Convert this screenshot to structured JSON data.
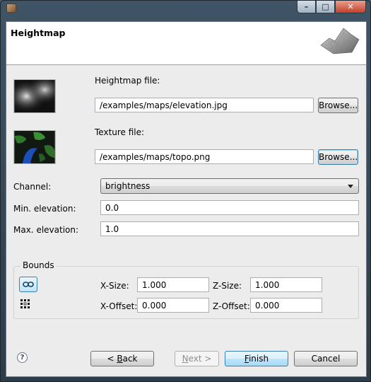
{
  "window": {
    "controls": {
      "minimize": "–",
      "maximize": "□",
      "close": "✕"
    }
  },
  "header": {
    "title": "Heightmap"
  },
  "heightmap": {
    "label": "Heightmap file:",
    "path": "/examples/maps/elevation.jpg",
    "browse_label": "Browse..."
  },
  "texture": {
    "label": "Texture file:",
    "path": "/examples/maps/topo.png",
    "browse_label": "Browse..."
  },
  "channel": {
    "label": "Channel:",
    "value": "brightness"
  },
  "min_elevation": {
    "label": "Min. elevation:",
    "value": "0.0"
  },
  "max_elevation": {
    "label": "Max. elevation:",
    "value": "1.0"
  },
  "bounds": {
    "title": "Bounds",
    "x_size": {
      "label": "X-Size:",
      "value": "1.000"
    },
    "z_size": {
      "label": "Z-Size:",
      "value": "1.000"
    },
    "x_offset": {
      "label": "X-Offset:",
      "value": "0.000"
    },
    "z_offset": {
      "label": "Z-Offset:",
      "value": "0.000"
    }
  },
  "footer": {
    "help": "?",
    "back_prefix": "< ",
    "back_mnemonic": "B",
    "back_rest": "ack",
    "next_mnemonic": "N",
    "next_rest": "ext >",
    "finish_mnemonic": "F",
    "finish_rest": "inish",
    "cancel": "Cancel"
  },
  "colors": {
    "accent": "#3c7fb1",
    "client_bg": "#ececec",
    "header_bg": "#ffffff",
    "titlebar": "#3f5566",
    "close_button": "#c2402a"
  },
  "icons": [
    "app-icon",
    "minimize-icon",
    "maximize-icon",
    "close-icon",
    "terrain-icon",
    "chevron-down-icon",
    "link-icon",
    "grid-icon",
    "help-icon"
  ]
}
